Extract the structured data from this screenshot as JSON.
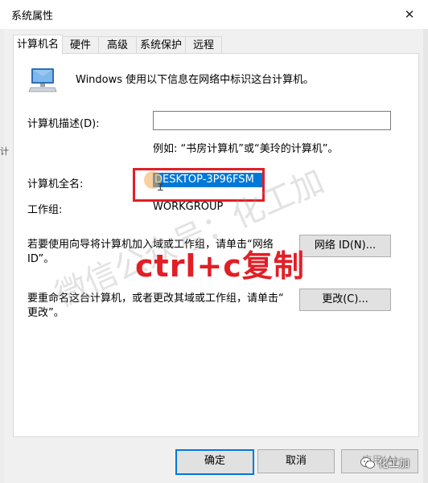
{
  "window": {
    "title": "系统属性",
    "close_glyph": "✕"
  },
  "tabs": [
    {
      "label": "计算机名",
      "active": true
    },
    {
      "label": "硬件",
      "active": false
    },
    {
      "label": "高级",
      "active": false
    },
    {
      "label": "系统保护",
      "active": false
    },
    {
      "label": "远程",
      "active": false
    }
  ],
  "computer_name_tab": {
    "icon": "computer-icon",
    "intro": "Windows 使用以下信息在网络中标识这台计算机。",
    "description_label": "计算机描述(D):",
    "description_value": "",
    "example": "例如: “书房计算机”或“美玲的计算机”。",
    "full_name_label": "计算机全名:",
    "full_name_value": "DESKTOP-3P96FSM",
    "workgroup_label": "工作组:",
    "workgroup_value": "WORKGROUP",
    "network_text_line1": "若要使用向导将计算机加入域或工作组，请单击“网络",
    "network_text_line2": "ID”。",
    "network_id_button": "网络 ID(N)...",
    "rename_text_line1": "要重命名这台计算机，或者更改其域或工作组，请单击“",
    "rename_text_line2": "更改”。",
    "change_button": "更改(C)..."
  },
  "annotation": {
    "text": "ctrl+c复制",
    "color": "#e21e26"
  },
  "watermark": {
    "text": "微信公众号：化工加",
    "badge": "化工加"
  },
  "footer": {
    "ok": "确定",
    "cancel": "取消",
    "apply": "应用(A)"
  },
  "colors": {
    "selection": "#0078d7",
    "highlight_box": "#e21e26",
    "primary_border": "#0078d7"
  }
}
